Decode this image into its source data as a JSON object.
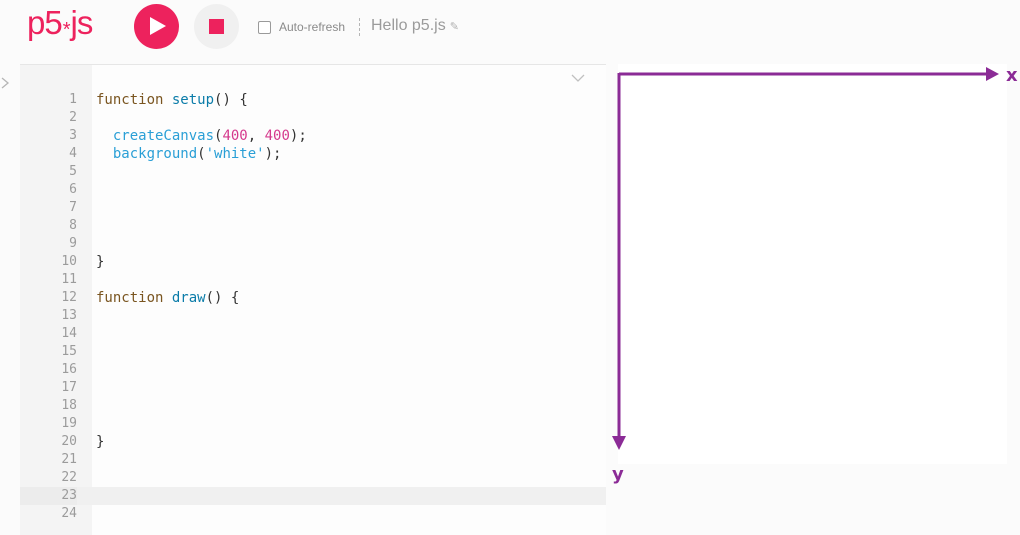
{
  "app": {
    "logo": {
      "main": "p5",
      "star": "*",
      "suffix": "js",
      "dot": "."
    },
    "brand_color": "#ed225d"
  },
  "toolbar": {
    "play_icon": "play-icon",
    "stop_icon": "stop-icon",
    "auto_refresh_label": "Auto-refresh",
    "auto_refresh_checked": false,
    "sketch_name": "Hello p5.js",
    "edit_icon": "pencil-icon"
  },
  "editor": {
    "active_line": 23,
    "lines": [
      {
        "n": "1",
        "code": "function setup() {"
      },
      {
        "n": "2",
        "code": ""
      },
      {
        "n": "3",
        "code": "  createCanvas(400, 400);"
      },
      {
        "n": "4",
        "code": "  background('white');"
      },
      {
        "n": "5",
        "code": ""
      },
      {
        "n": "6",
        "code": ""
      },
      {
        "n": "7",
        "code": ""
      },
      {
        "n": "8",
        "code": ""
      },
      {
        "n": "9",
        "code": ""
      },
      {
        "n": "10",
        "code": "}"
      },
      {
        "n": "11",
        "code": ""
      },
      {
        "n": "12",
        "code": "function draw() {"
      },
      {
        "n": "13",
        "code": ""
      },
      {
        "n": "14",
        "code": ""
      },
      {
        "n": "15",
        "code": ""
      },
      {
        "n": "16",
        "code": ""
      },
      {
        "n": "17",
        "code": ""
      },
      {
        "n": "18",
        "code": ""
      },
      {
        "n": "19",
        "code": ""
      },
      {
        "n": "20",
        "code": "}"
      },
      {
        "n": "21",
        "code": ""
      },
      {
        "n": "22",
        "code": ""
      },
      {
        "n": "23",
        "code": ""
      },
      {
        "n": "24",
        "code": ""
      }
    ]
  },
  "preview": {
    "x_axis_label": "x",
    "y_axis_label": "y",
    "axis_color": "#8b2b96"
  }
}
